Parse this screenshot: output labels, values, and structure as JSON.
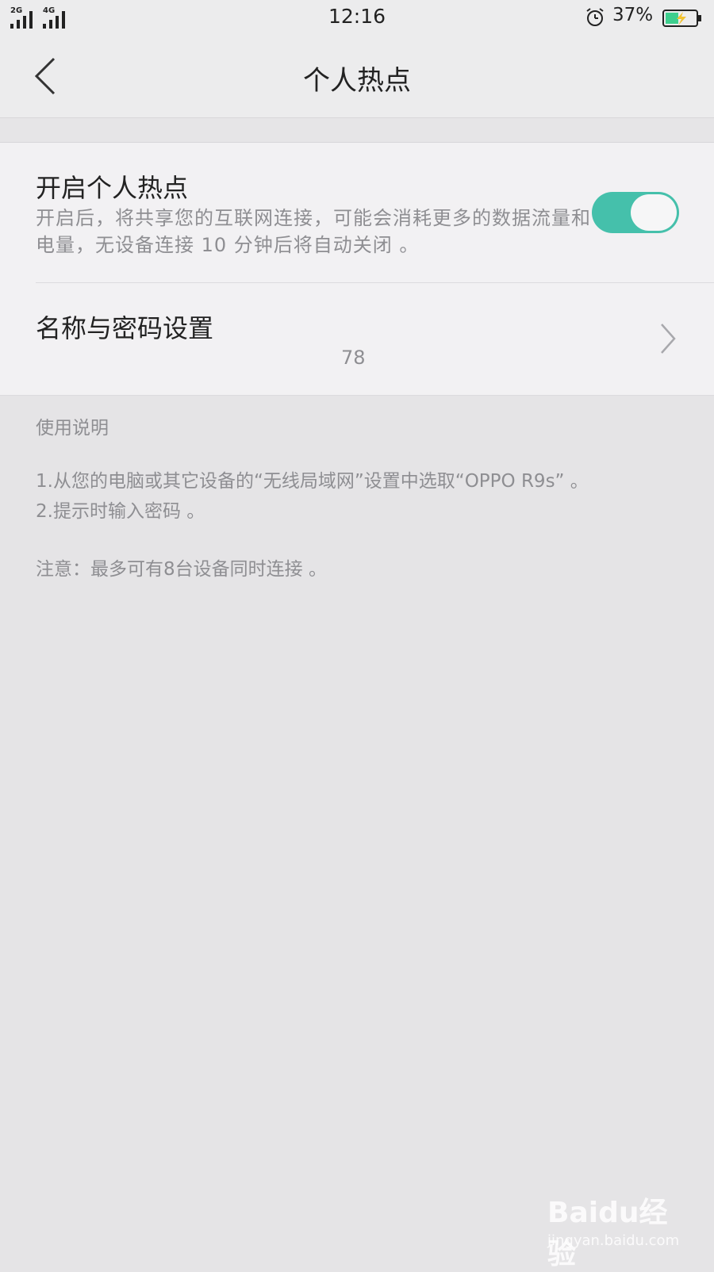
{
  "status_bar": {
    "network_1": "2G",
    "network_2": "4G",
    "time": "12:16",
    "battery_percent": "37%",
    "icons": [
      "signal-icon",
      "signal-icon",
      "alarm-icon",
      "battery-charging-icon"
    ]
  },
  "nav": {
    "title": "个人热点",
    "back_icon": "back-chevron-icon"
  },
  "hotspot": {
    "title": "开启个人热点",
    "description": "开启后，将共享您的互联网连接，可能会消耗更多的数据流量和电量，无设备连接 10 分钟后将自动关闭 。",
    "toggle_on": true
  },
  "name_password": {
    "label": "名称与密码设置",
    "value": "78",
    "chevron_icon": "chevron-right-icon"
  },
  "help": {
    "title": "使用说明",
    "lines": [
      "1.从您的电脑或其它设备的“无线局域网”设置中选取“OPPO R9s” 。",
      "2.提示时输入密码 。"
    ],
    "note": "注意：最多可有8台设备同时连接 。"
  },
  "watermark": {
    "brand": "Baidu经验",
    "url": "jingyan.baidu.com"
  },
  "colors": {
    "accent": "#45c0ab",
    "background": "#e5e4e6",
    "card": "#f2f1f3",
    "secondary_text": "#8e8e92"
  }
}
